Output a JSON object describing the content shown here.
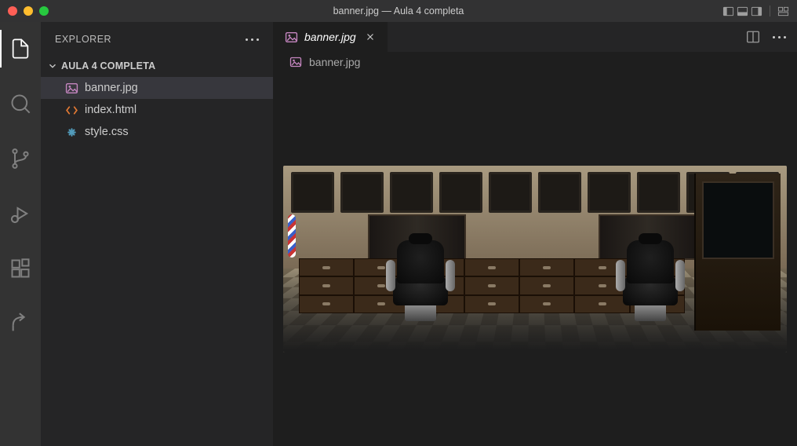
{
  "window": {
    "title": "banner.jpg — Aula 4 completa"
  },
  "sidebar": {
    "title": "EXPLORER",
    "folder": "AULA 4 COMPLETA",
    "files": [
      {
        "name": "banner.jpg",
        "icon": "image-icon",
        "color": "#c586c0",
        "selected": true
      },
      {
        "name": "index.html",
        "icon": "html-icon",
        "color": "#e37933",
        "selected": false
      },
      {
        "name": "style.css",
        "icon": "css-icon",
        "color": "#519aba",
        "selected": false
      }
    ]
  },
  "editor": {
    "tab": {
      "label": "banner.jpg",
      "icon": "image-icon",
      "iconColor": "#c586c0"
    },
    "breadcrumb": "banner.jpg"
  }
}
